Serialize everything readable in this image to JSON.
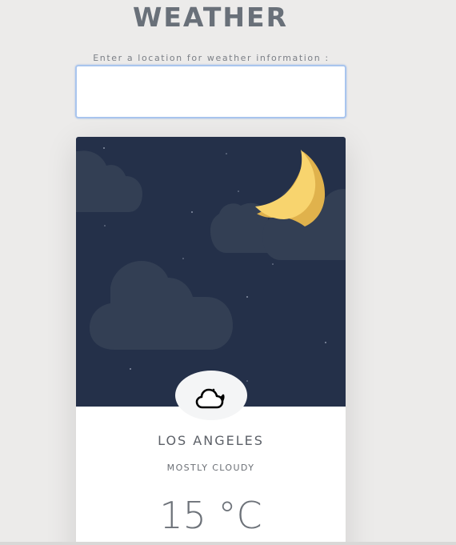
{
  "header": {
    "title": "WEATHER"
  },
  "search": {
    "label": "Enter a location for weather information :",
    "value": "",
    "placeholder": ""
  },
  "weather": {
    "city": "LOS ANGELES",
    "condition": "MOSTLY CLOUDY",
    "temperature": "15 °C",
    "condition_icon": "cloud-moon-icon",
    "scene": "night-sky-with-crescent-moon-and-clouds"
  },
  "colors": {
    "background": "#ecebea",
    "sky": "#243049",
    "cloud": "#333f54",
    "moon": "#f8d46e",
    "title_text": "#697079",
    "input_border": "#a9c5ee"
  }
}
